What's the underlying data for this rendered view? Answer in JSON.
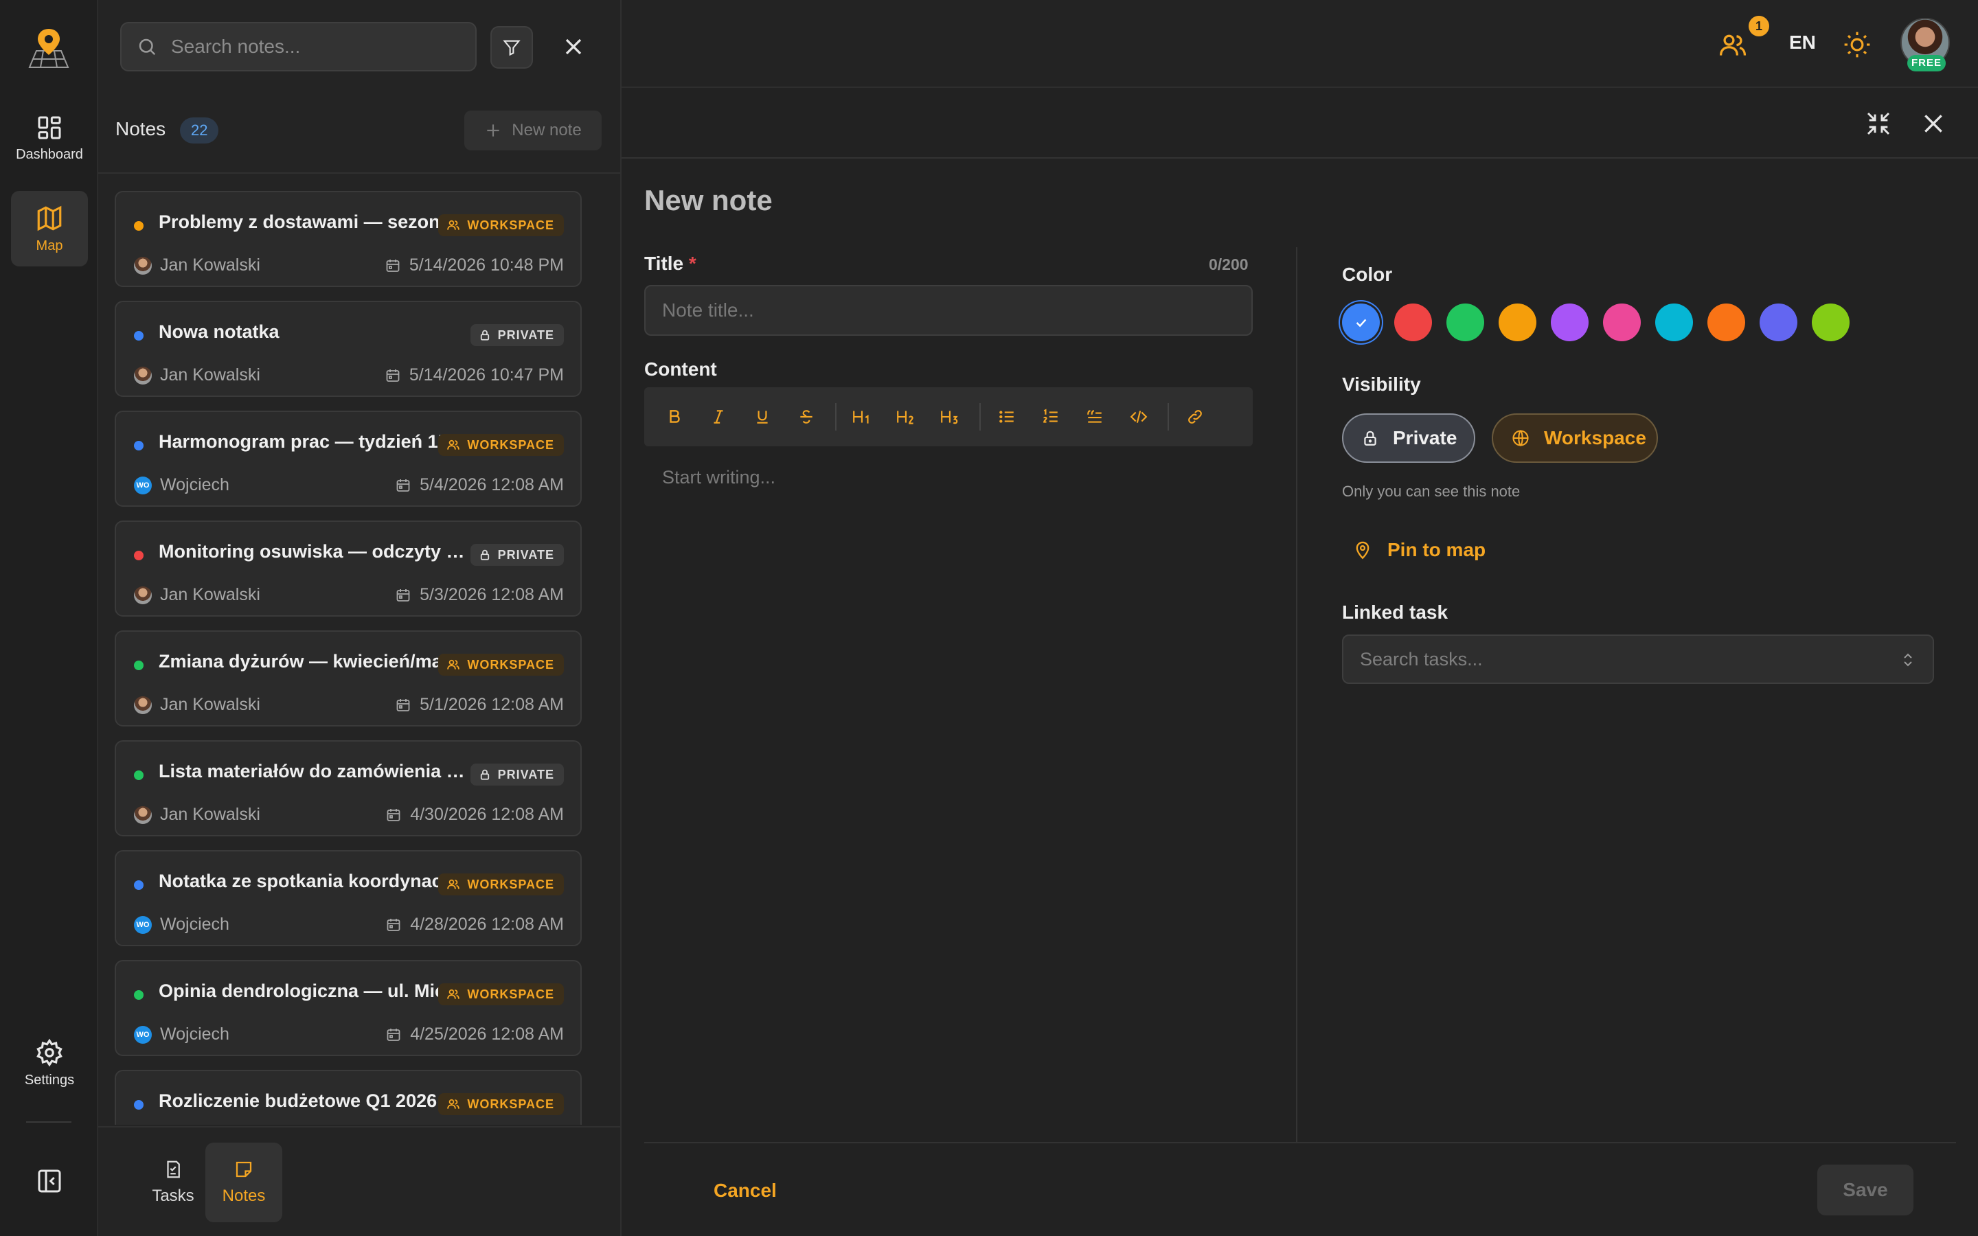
{
  "nav": {
    "items": [
      {
        "label": "Dashboard"
      },
      {
        "label": "Map"
      },
      {
        "label": "Settings"
      }
    ]
  },
  "notes_panel": {
    "search_placeholder": "Search notes...",
    "heading": "Notes",
    "count": "22",
    "new_note_label": "New note",
    "notes": [
      {
        "title": "Problemy z dostawami — sezon ...",
        "visibility": "WORKSPACE",
        "author": "Jan Kowalski",
        "author_initials": "",
        "date": "5/14/2026 10:48 PM",
        "color": "#f59e0b"
      },
      {
        "title": "Nowa notatka",
        "visibility": "PRIVATE",
        "author": "Jan Kowalski",
        "author_initials": "",
        "date": "5/14/2026 10:47 PM",
        "color": "#3b82f6"
      },
      {
        "title": "Harmonogram prac — tydzień 15...",
        "visibility": "WORKSPACE",
        "author": "Wojciech",
        "author_initials": "WO",
        "date": "5/4/2026 12:08 AM",
        "color": "#3b82f6"
      },
      {
        "title": "Monitoring osuwiska — odczyty ink...",
        "visibility": "PRIVATE",
        "author": "Jan Kowalski",
        "author_initials": "",
        "date": "5/3/2026 12:08 AM",
        "color": "#ef4444"
      },
      {
        "title": "Zmiana dyżurów — kwiecień/maj",
        "visibility": "WORKSPACE",
        "author": "Jan Kowalski",
        "author_initials": "",
        "date": "5/1/2026 12:08 AM",
        "color": "#22c55e"
      },
      {
        "title": "Lista materiałów do zamówienia — ...",
        "visibility": "PRIVATE",
        "author": "Jan Kowalski",
        "author_initials": "",
        "date": "4/30/2026 12:08 AM",
        "color": "#22c55e"
      },
      {
        "title": "Notatka ze spotkania koordynac...",
        "visibility": "WORKSPACE",
        "author": "Wojciech",
        "author_initials": "WO",
        "date": "4/28/2026 12:08 AM",
        "color": "#3b82f6"
      },
      {
        "title": "Opinia dendrologiczna — ul. Mic...",
        "visibility": "WORKSPACE",
        "author": "Wojciech",
        "author_initials": "WO",
        "date": "4/25/2026 12:08 AM",
        "color": "#22c55e"
      },
      {
        "title": "Rozliczenie budżetowe Q1 2026",
        "visibility": "WORKSPACE",
        "author": "",
        "author_initials": "",
        "date": "",
        "color": "#3b82f6"
      }
    ],
    "tabs": [
      {
        "label": "Tasks"
      },
      {
        "label": "Notes"
      }
    ]
  },
  "topbar": {
    "team_count": "1",
    "language": "EN",
    "plan_badge": "FREE"
  },
  "editor": {
    "heading": "New note",
    "title_label": "Title",
    "required_mark": "*",
    "char_count": "0/200",
    "title_placeholder": "Note title...",
    "content_label": "Content",
    "content_placeholder": "Start writing...",
    "toolbar_icons": [
      "bold-icon",
      "italic-icon",
      "underline-icon",
      "strikethrough-icon",
      "heading1-icon",
      "heading2-icon",
      "heading3-icon",
      "bullet-list-icon",
      "ordered-list-icon",
      "blockquote-icon",
      "code-icon",
      "link-icon"
    ],
    "color_label": "Color",
    "colors": [
      "#3b82f6",
      "#ef4444",
      "#22c55e",
      "#f59e0b",
      "#a855f7",
      "#ec4899",
      "#06b6d4",
      "#f97316",
      "#6366f1",
      "#84cc16"
    ],
    "selected_color": "#3b82f6",
    "visibility_label": "Visibility",
    "private_label": "Private",
    "workspace_label": "Workspace",
    "visibility_hint": "Only you can see this note",
    "pin_label": "Pin to map",
    "linked_task_label": "Linked task",
    "task_placeholder": "Search tasks...",
    "cancel_label": "Cancel",
    "save_label": "Save"
  },
  "accent_color": "#f5a623"
}
